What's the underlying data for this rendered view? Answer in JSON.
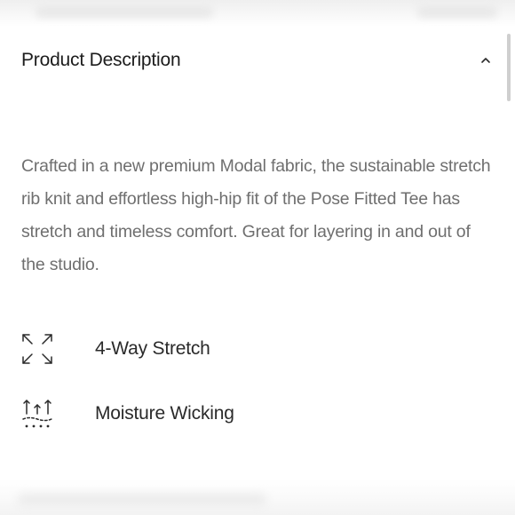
{
  "accordion": {
    "title": "Product Description",
    "state_icon": "chevron-up-icon",
    "description": "Crafted in a new premium Modal fabric, the sustainable stretch rib knit and effortless high-hip fit of the Pose Fitted Tee has stretch and timeless comfort. Great for layering in and out of the studio."
  },
  "features": [
    {
      "label": "4-Way Stretch",
      "icon": "four-way-stretch-icon"
    },
    {
      "label": "Moisture Wicking",
      "icon": "moisture-wicking-icon"
    }
  ],
  "colors": {
    "title": "#1c1c1c",
    "body_text": "#6f6f6f",
    "feature_text": "#2a2a2a",
    "icon": "#2a2a2a",
    "scrollbar": "#cfcfcf"
  }
}
